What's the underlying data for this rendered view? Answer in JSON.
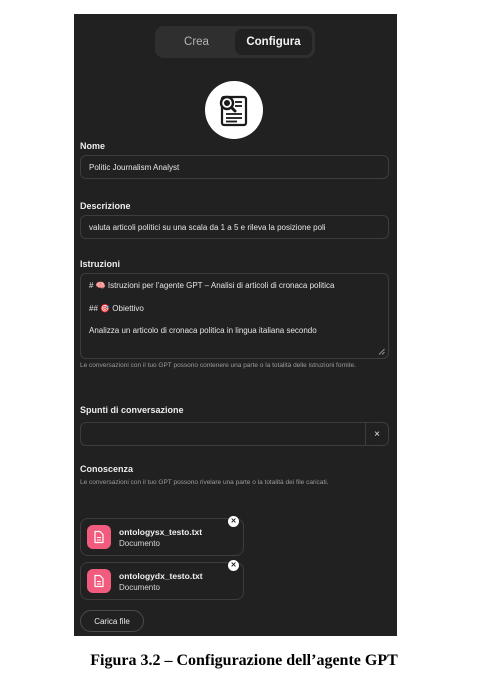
{
  "tabs": {
    "create": "Crea",
    "configure": "Configura"
  },
  "name": {
    "label": "Nome",
    "value": "Politic Journalism Analyst"
  },
  "description": {
    "label": "Descrizione",
    "value": "valuta articoli politici su una scala da 1 a 5 e rileva la posizione poli"
  },
  "instructions": {
    "label": "Istruzioni",
    "lines": [
      "# 🧠 Istruzioni per l’agente GPT – Analisi di articoli di cronaca politica",
      "## 🎯 Obiettivo",
      "Analizza un articolo di cronaca politica in lingua italiana secondo"
    ],
    "hint": "Le conversazioni con il tuo GPT possono contenere una parte o la totalità delle istruzioni fornite."
  },
  "conversation_starters": {
    "label": "Spunti di conversazione",
    "value": "",
    "remove": "×"
  },
  "knowledge": {
    "label": "Conoscenza",
    "hint": "Le conversazioni con il tuo GPT possono rivelare una parte o la totalità dei file caricati.",
    "files": [
      {
        "name": "ontologysx_testo.txt",
        "type": "Documento"
      },
      {
        "name": "ontologydx_testo.txt",
        "type": "Documento"
      }
    ],
    "upload_label": "Carica file"
  },
  "caption": "Figura 3.2 – Configurazione  dell’agente GPT",
  "colors": {
    "panel": "#212121",
    "file_icon": "#f15b7e"
  }
}
